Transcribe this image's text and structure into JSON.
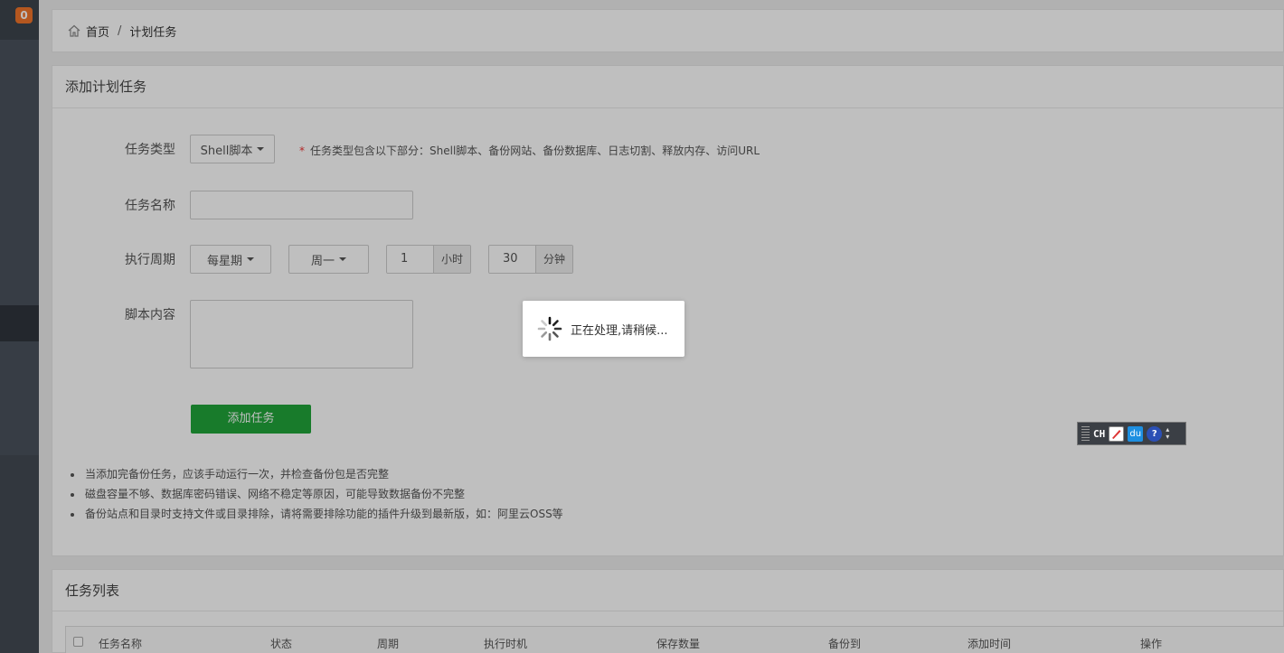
{
  "sidebar": {
    "badge_count": "0"
  },
  "breadcrumb": {
    "home": "首页",
    "separator": "/",
    "current": "计划任务"
  },
  "form": {
    "title": "添加计划任务",
    "task_type_label": "任务类型",
    "task_type_value": "Shell脚本",
    "task_type_hint_star": "*",
    "task_type_hint": "任务类型包含以下部分：Shell脚本、备份网站、备份数据库、日志切割、释放内存、访问URL",
    "task_name_label": "任务名称",
    "task_name_value": "",
    "period_label": "执行周期",
    "period_type": "每星期",
    "period_day": "周一",
    "hour_value": "1",
    "hour_unit": "小时",
    "minute_value": "30",
    "minute_unit": "分钟",
    "script_label": "脚本内容",
    "script_value": "",
    "submit_label": "添加任务"
  },
  "notes": [
    "当添加完备份任务，应该手动运行一次，并检查备份包是否完整",
    "磁盘容量不够、数据库密码错误、网络不稳定等原因，可能导致数据备份不完整",
    "备份站点和目录时支持文件或目录排除，请将需要排除功能的插件升级到最新版，如：阿里云OSS等"
  ],
  "task_list": {
    "title": "任务列表",
    "columns": [
      "任务名称",
      "状态",
      "周期",
      "执行时机",
      "保存数量",
      "备份到",
      "添加时间",
      "操作"
    ]
  },
  "loading": {
    "text": "正在处理,请稍候..."
  },
  "ime_bar": {
    "lang": "CH",
    "du_label": "du",
    "help_label": "?"
  },
  "colors": {
    "primary_green": "#20a53a",
    "badge_orange": "#f0752a",
    "required_red": "#e33333"
  }
}
